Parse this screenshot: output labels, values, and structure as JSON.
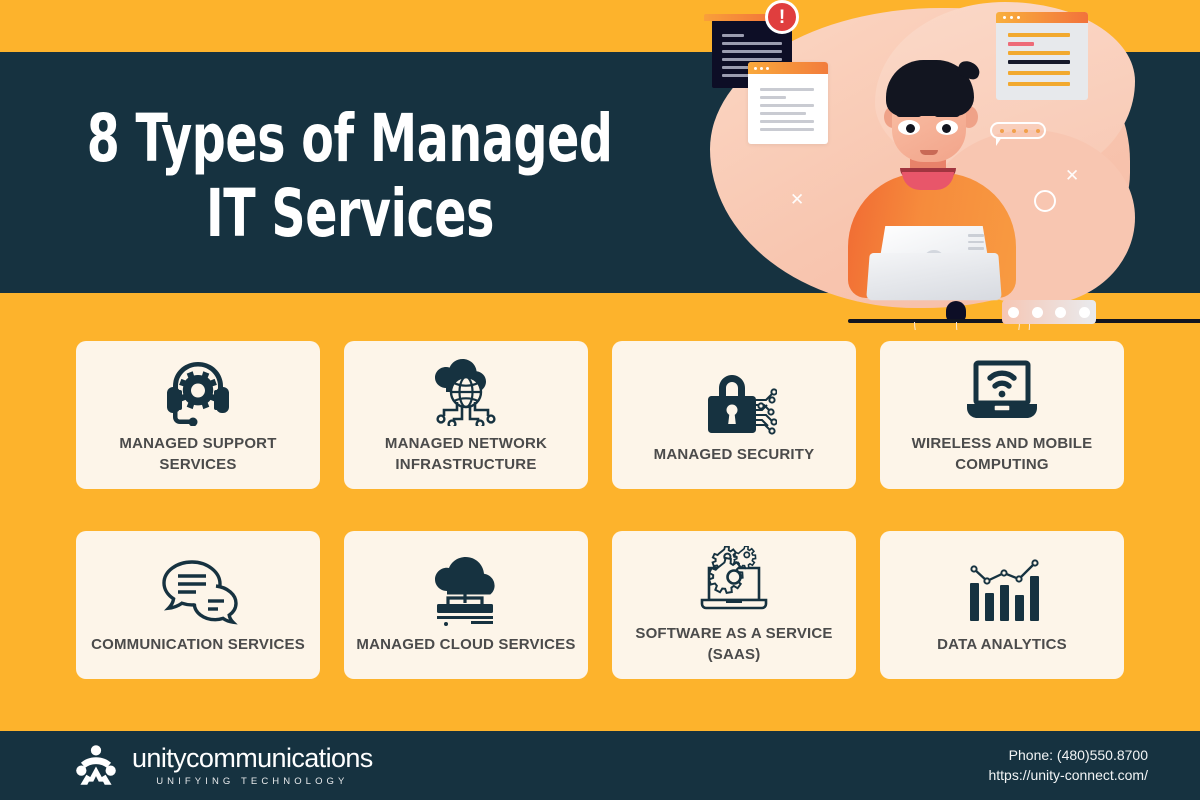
{
  "colors": {
    "accent_orange": "#FDB32C",
    "dark_navy": "#163240",
    "card_cream": "#FDF5E9",
    "icon_navy": "#163240",
    "label_gray": "#4B4B4B",
    "alert_red": "#E03E3E"
  },
  "header": {
    "title_line1": "8 Types of Managed",
    "title_line2": "IT Services",
    "alert_badge": "!",
    "illustration": {
      "name": "man-working-on-laptop-illustration",
      "pager_dots": 4
    }
  },
  "cards": [
    {
      "label": "MANAGED SUPPORT SERVICES",
      "icon": "headset-gear-icon"
    },
    {
      "label": "MANAGED NETWORK INFRASTRUCTURE",
      "icon": "cloud-globe-network-icon"
    },
    {
      "label": "MANAGED SECURITY",
      "icon": "padlock-circuit-icon"
    },
    {
      "label": "WIRELESS AND MOBILE COMPUTING",
      "icon": "laptop-wifi-icon"
    },
    {
      "label": "COMMUNICATION SERVICES",
      "icon": "speech-bubbles-icon"
    },
    {
      "label": "MANAGED CLOUD SERVICES",
      "icon": "cloud-servers-icon"
    },
    {
      "label": "SOFTWARE AS A SERVICE (SAAS)",
      "icon": "laptop-gears-icon"
    },
    {
      "label": "DATA ANALYTICS",
      "icon": "bar-chart-trend-icon"
    }
  ],
  "footer": {
    "brand_name": "unitycommunications",
    "brand_tagline": "UNIFYING TECHNOLOGY",
    "phone": "Phone: (480)550.8700",
    "website": "https://unity-connect.com/"
  }
}
